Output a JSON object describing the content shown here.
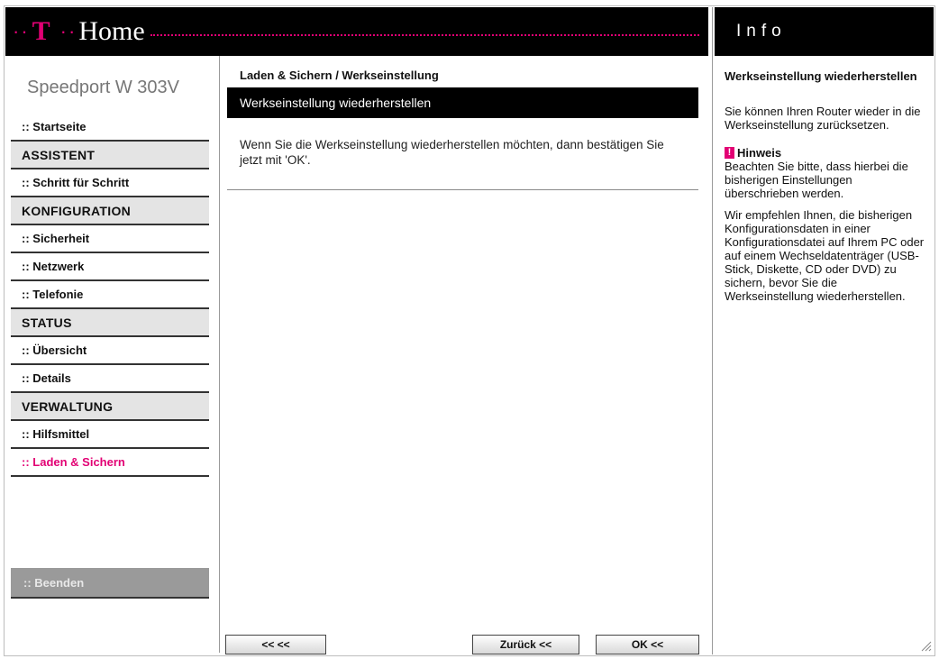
{
  "header": {
    "logo_letter": "T",
    "brand": "Home"
  },
  "info_panel": {
    "title": "Info",
    "heading": "Werkseinstellung wiederherstellen",
    "paragraph1": "Sie können Ihren Router wieder in die Werkseinstellung zurücksetzen.",
    "hint_label": "Hinweis",
    "hint_icon_glyph": "!",
    "hint_text": "Beachten Sie bitte, dass hierbei die bisherigen Einstellungen überschrieben werden.",
    "paragraph2": "Wir empfehlen Ihnen, die bisherigen Konfigurationsdaten in einer Konfigurationsdatei auf Ihrem PC oder auf einem Wechseldatenträger (USB-Stick, Diskette, CD oder DVD) zu sichern, bevor Sie die Werkseinstellung wiederherstellen."
  },
  "sidebar": {
    "product": "Speedport W 303V",
    "items": [
      {
        "label": ":: Startseite",
        "kind": "link"
      },
      {
        "label": "ASSISTENT",
        "kind": "section"
      },
      {
        "label": ":: Schritt für Schritt",
        "kind": "link"
      },
      {
        "label": "KONFIGURATION",
        "kind": "section"
      },
      {
        "label": ":: Sicherheit",
        "kind": "link"
      },
      {
        "label": ":: Netzwerk",
        "kind": "link"
      },
      {
        "label": ":: Telefonie",
        "kind": "link"
      },
      {
        "label": "STATUS",
        "kind": "section"
      },
      {
        "label": ":: Übersicht",
        "kind": "link"
      },
      {
        "label": ":: Details",
        "kind": "link"
      },
      {
        "label": "VERWALTUNG",
        "kind": "section"
      },
      {
        "label": ":: Hilfsmittel",
        "kind": "link"
      },
      {
        "label": ":: Laden & Sichern",
        "kind": "link",
        "active": true
      }
    ],
    "logout": ":: Beenden"
  },
  "main": {
    "breadcrumb": "Laden & Sichern / Werkseinstellung",
    "title": "Werkseinstellung wiederherstellen",
    "message": "Wenn Sie die Werkseinstellung wiederherstellen möchten, dann bestätigen Sie jetzt mit 'OK'."
  },
  "buttons": {
    "back_start": "<< <<",
    "back": "Zurück <<",
    "ok": "OK <<"
  },
  "colors": {
    "accent": "#e20074",
    "header_bg": "#000000",
    "section_bg": "#e4e4e4",
    "logout_bg": "#9a9a9a"
  }
}
